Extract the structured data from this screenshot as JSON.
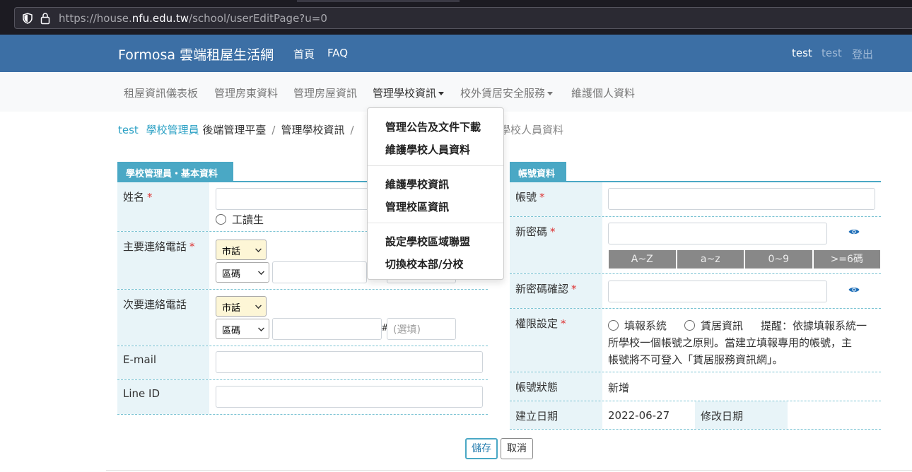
{
  "browser": {
    "url_prefix": "https://house.",
    "url_domain": "nfu.edu.tw",
    "url_path": "/school/userEditPage?u=0"
  },
  "topnav": {
    "brand": "Formosa 雲端租屋生活網",
    "home": "首頁",
    "faq": "FAQ",
    "user1": "test",
    "user2": "test",
    "logout": "登出"
  },
  "subnav": {
    "items": [
      "租屋資訊儀表板",
      "管理房東資料",
      "管理房屋資訊",
      "管理學校資訊",
      "校外賃居安全服務",
      "維護個人資料"
    ]
  },
  "breadcrumb": {
    "user": "test",
    "role": "學校管理員",
    "platform": "後端管理平臺",
    "sep": "/",
    "section": "管理學校資訊",
    "tail": "學校人員資料"
  },
  "dropdown": {
    "items": [
      "管理公告及文件下載",
      "維護學校人員資料",
      "維護學校資訊",
      "管理校區資訊",
      "設定學校區域聯盟",
      "切換校本部/分校"
    ]
  },
  "left_panel": {
    "title": "學校管理員・基本資料",
    "name_label": "姓名",
    "required": "*",
    "work_study": "工讀生",
    "phone1_label": "主要連絡電話",
    "phone2_label": "次要連絡電話",
    "phone_type": "市話",
    "area_code": "區碼",
    "hash": "#",
    "ext_placeholder": "(選填)",
    "email_label": "E-mail",
    "line_label": "Line ID"
  },
  "right_panel": {
    "title": "帳號資料",
    "account_label": "帳號",
    "new_pw_label": "新密碼",
    "pw_rules": [
      "A~Z",
      "a~z",
      "0~9",
      ">=6碼"
    ],
    "confirm_pw_label": "新密碼確認",
    "permission_label": "權限設定",
    "perm_opt1": "填報系統",
    "perm_opt2": "賃居資訊",
    "perm_note_1": "提醒：依據填報系統一",
    "perm_note_2": "所學校一個帳號之原則。當建立填報專用的帳號，主",
    "perm_note_3": "帳號將不可登入「賃居服務資訊網」。",
    "status_label": "帳號狀態",
    "status_value": "新增",
    "created_label": "建立日期",
    "created_value": "2022-06-27",
    "modified_label": "修改日期"
  },
  "buttons": {
    "save": "儲存",
    "cancel": "取消"
  },
  "colors": {
    "navbar": "#3c6fa5",
    "accent": "#4aa8c5",
    "required": "#d33"
  }
}
